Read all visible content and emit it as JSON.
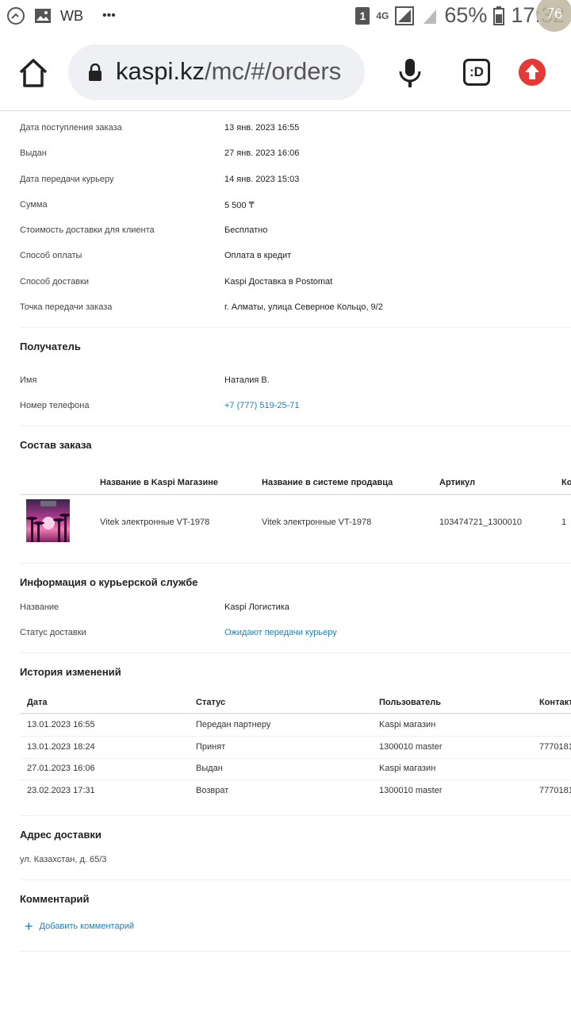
{
  "statusbar": {
    "app_label": "WB",
    "dots": "•••",
    "sim": "1",
    "network": "4G",
    "battery": "65%",
    "time": "17:32",
    "badge": "76"
  },
  "browser": {
    "url_host": "kaspi.kz",
    "url_path": "/mc/#/orders"
  },
  "order": {
    "fields": [
      {
        "label": "Дата поступления заказа",
        "value": "13 янв. 2023 16:55"
      },
      {
        "label": "Выдан",
        "value": "27 янв. 2023 16:06"
      },
      {
        "label": "Дата передачи курьеру",
        "value": "14 янв. 2023 15:03"
      },
      {
        "label": "Сумма",
        "value": "5 500 ₸"
      },
      {
        "label": "Стоимость доставки для клиента",
        "value": "Бесплатно"
      },
      {
        "label": "Способ оплаты",
        "value": "Оплата в кредит"
      },
      {
        "label": "Способ доставки",
        "value": "Kaspi Доставка в Postomat"
      },
      {
        "label": "Точка передачи заказа",
        "value": "г. Алматы, улица Северное Кольцо, 9/2"
      }
    ]
  },
  "recipient": {
    "title": "Получатель",
    "name_label": "Имя",
    "name_value": "Наталия В.",
    "phone_label": "Номер телефона",
    "phone_value": "+7 (777) 519-25-71"
  },
  "composition": {
    "title": "Состав заказа",
    "headers": [
      "Название в Kaspi Магазине",
      "Название в системе продавца",
      "Артикул",
      "Ко"
    ],
    "item": {
      "kaspi_name": "Vitek электронные VT-1978",
      "seller_name": "Vitek электронные VT-1978",
      "article": "103474721_1300010",
      "qty": "1"
    }
  },
  "courier": {
    "title": "Информация о курьерской службе",
    "name_label": "Название",
    "name_value": "Kaspi Логистика",
    "status_label": "Статус доставки",
    "status_value": "Ожидают передачи курьеру"
  },
  "history": {
    "title": "История изменений",
    "headers": [
      "Дата",
      "Статус",
      "Пользователь",
      "Контакт"
    ],
    "rows": [
      {
        "date": "13.01.2023 16:55",
        "status": "Передан партнеру",
        "user": "Kaspi магазин",
        "contact": ""
      },
      {
        "date": "13.01.2023 18:24",
        "status": "Принят",
        "user": "1300010 master",
        "contact": "7770181"
      },
      {
        "date": "27.01.2023 16:06",
        "status": "Выдан",
        "user": "Kaspi магазин",
        "contact": ""
      },
      {
        "date": "23.02.2023 17:31",
        "status": "Возврат",
        "user": "1300010 master",
        "contact": "7770181"
      }
    ]
  },
  "address": {
    "title": "Адрес доставки",
    "value": "ул. Казахстан, д. 65/3"
  },
  "comment": {
    "title": "Комментарий",
    "add_label": "Добавить комментарий"
  }
}
